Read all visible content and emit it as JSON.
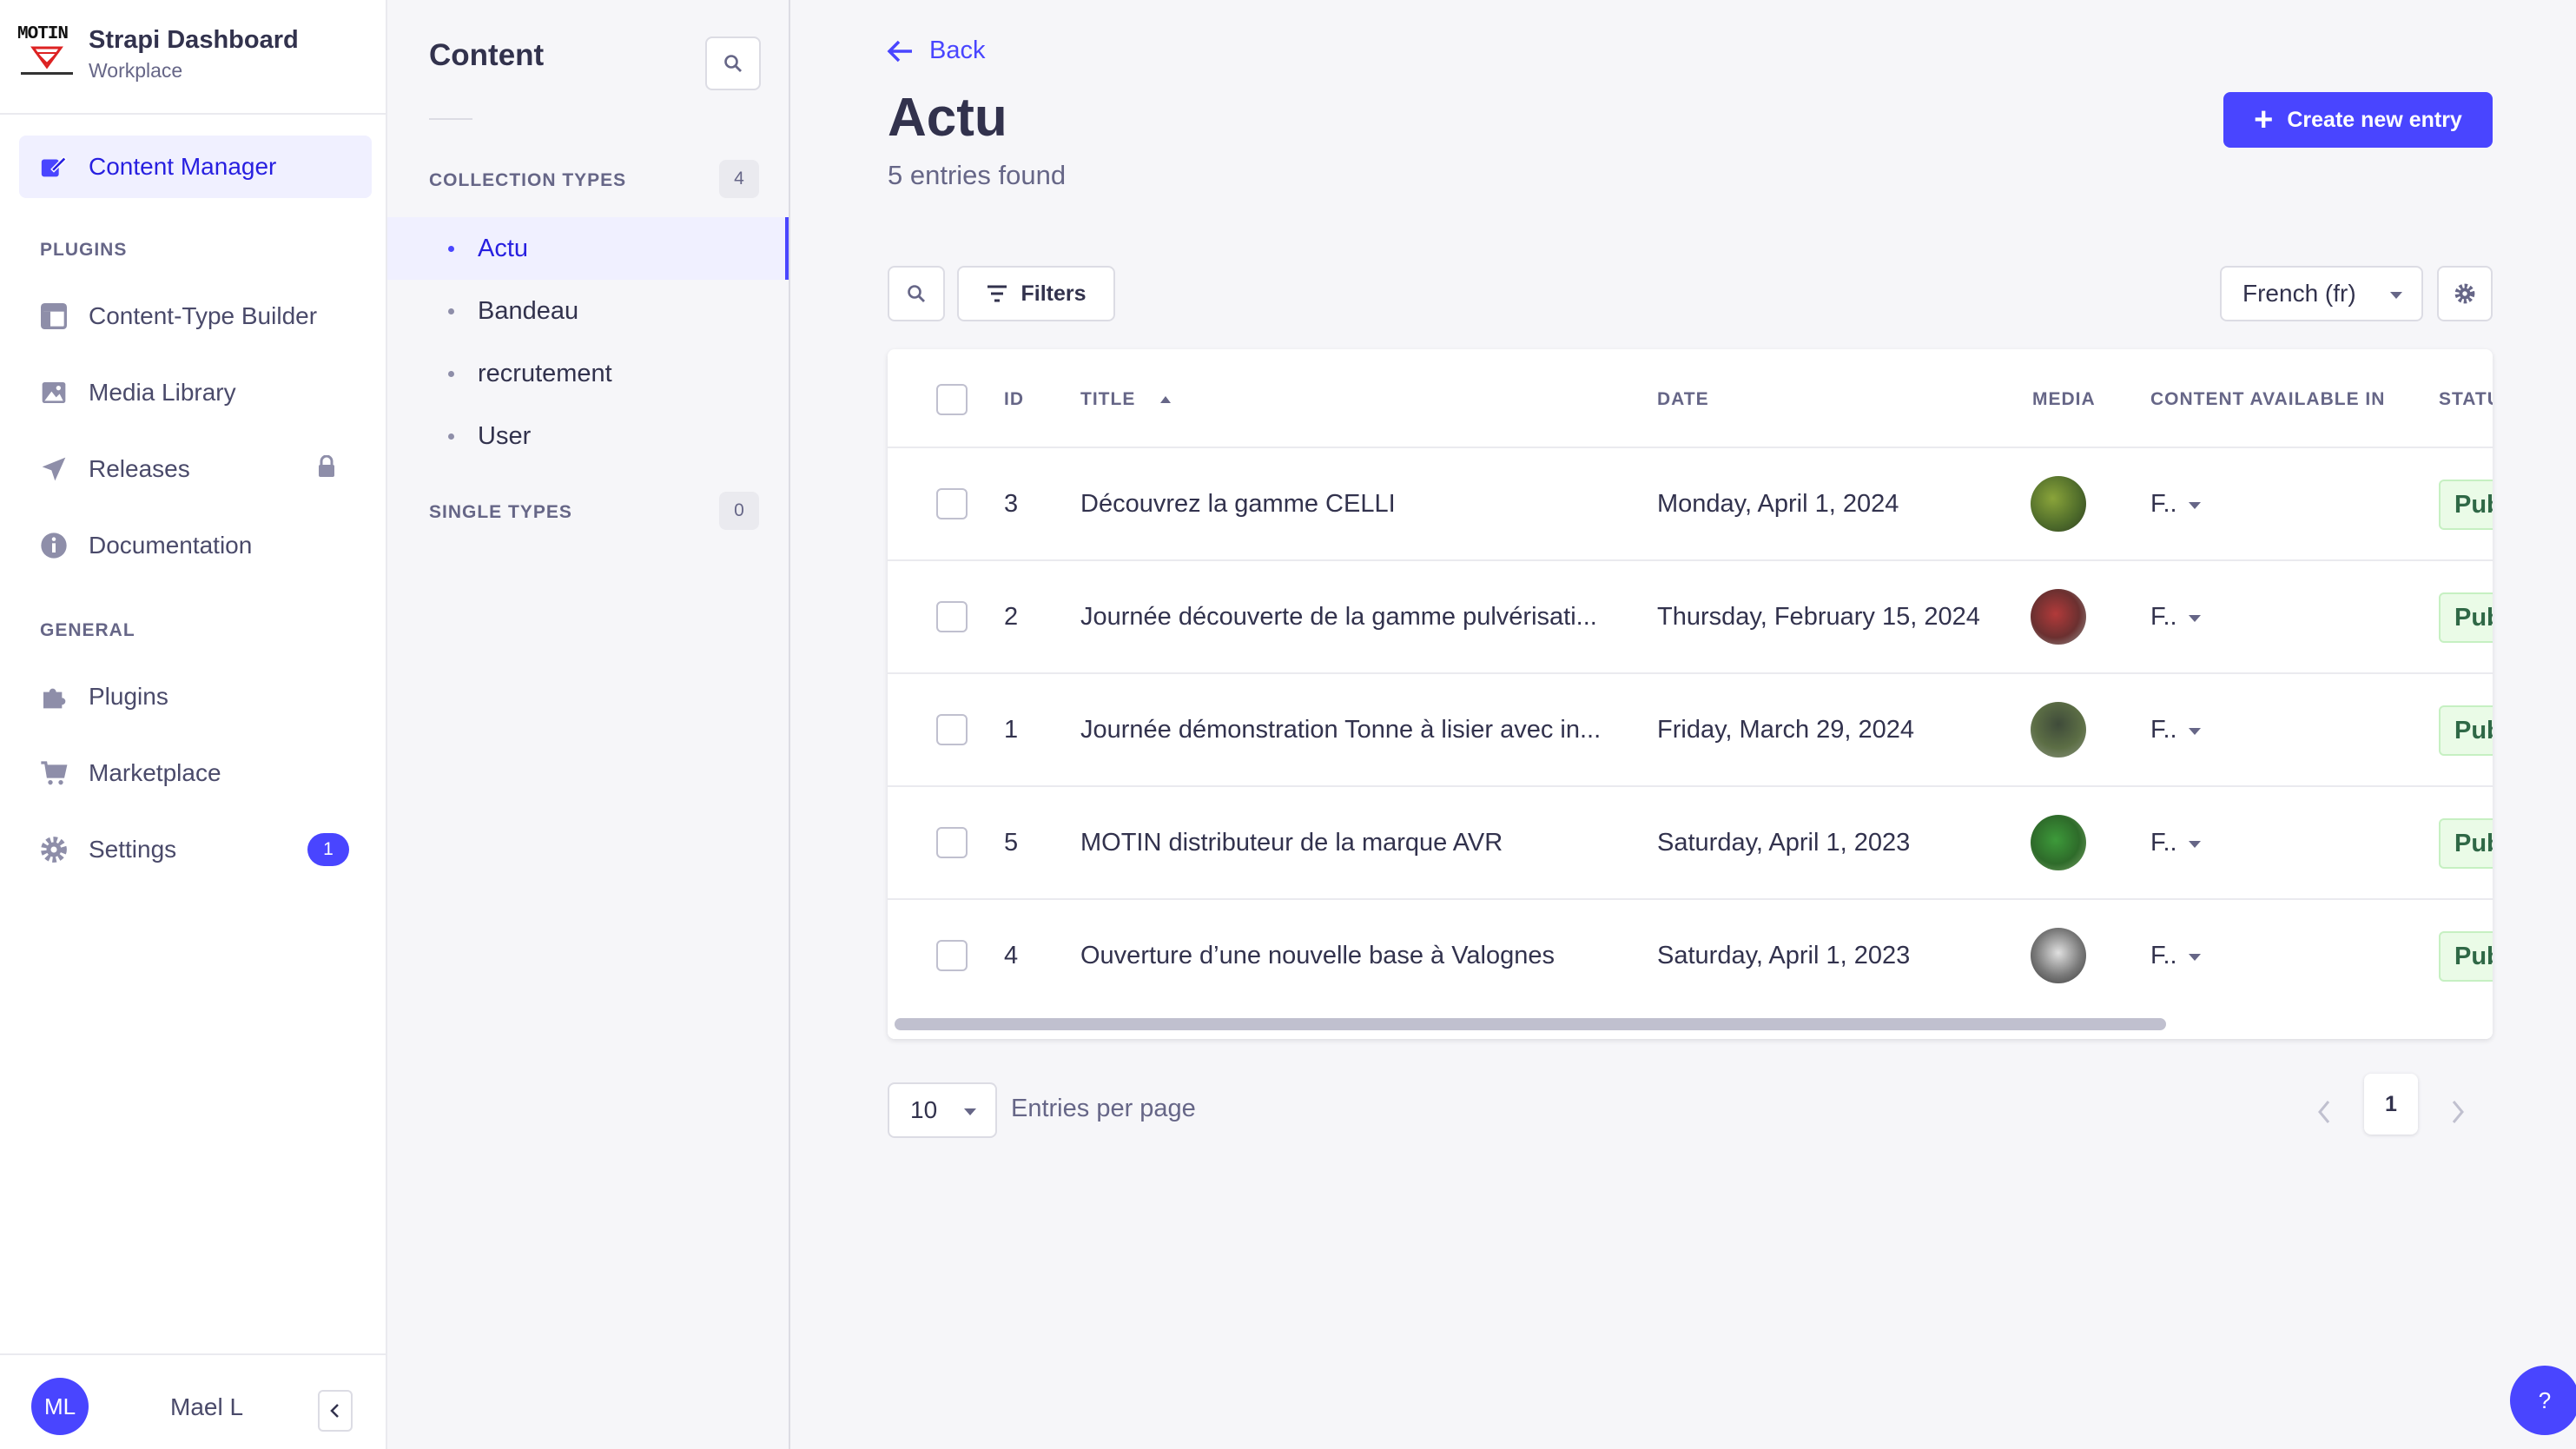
{
  "brand": {
    "logo_text": "MOTIN",
    "title": "Strapi Dashboard",
    "subtitle": "Workplace"
  },
  "mainnav": {
    "content_manager": "Content Manager",
    "plugins_section": "PLUGINS",
    "content_type_builder": "Content-Type Builder",
    "media_library": "Media Library",
    "releases": "Releases",
    "documentation": "Documentation",
    "general_section": "GENERAL",
    "plugins": "Plugins",
    "marketplace": "Marketplace",
    "settings": "Settings",
    "settings_badge": "1"
  },
  "user": {
    "initials": "ML",
    "name": "Mael L"
  },
  "subnav": {
    "title": "Content",
    "collection_types_label": "COLLECTION TYPES",
    "collection_types_count": "4",
    "collection_types": [
      "Actu",
      "Bandeau",
      "recrutement",
      "User"
    ],
    "single_types_label": "SINGLE TYPES",
    "single_types_count": "0"
  },
  "main": {
    "back_label": "Back",
    "title": "Actu",
    "subtitle": "5 entries found",
    "create_label": "Create new entry",
    "filters_label": "Filters",
    "locale": "French (fr)"
  },
  "table": {
    "headers": {
      "id": "ID",
      "title": "TITLE",
      "date": "DATE",
      "media": "MEDIA",
      "content_available": "CONTENT AVAILABLE IN",
      "status": "STATUS"
    },
    "rows": [
      {
        "id": "3",
        "title": "Découvrez la gamme CELLI",
        "date": "Monday, April 1, 2024",
        "locale": "F..",
        "status": "Published"
      },
      {
        "id": "2",
        "title": "Journée découverte de la gamme pulvérisati...",
        "date": "Thursday, February 15, 2024",
        "locale": "F..",
        "status": "Published"
      },
      {
        "id": "1",
        "title": "Journée démonstration Tonne à lisier avec in...",
        "date": "Friday, March 29, 2024",
        "locale": "F..",
        "status": "Published"
      },
      {
        "id": "5",
        "title": "MOTIN distributeur de la marque AVR",
        "date": "Saturday, April 1, 2023",
        "locale": "F..",
        "status": "Published"
      },
      {
        "id": "4",
        "title": "Ouverture d’une nouvelle base à Valognes",
        "date": "Saturday, April 1, 2023",
        "locale": "F..",
        "status": "Published"
      }
    ]
  },
  "pagination": {
    "page_size": "10",
    "per_page_label": "Entries per page",
    "current_page": "1"
  },
  "help_label": "?",
  "colors": {
    "primary": "#4945ff",
    "success_bg": "#eafbe7",
    "success_text": "#2f6846"
  }
}
